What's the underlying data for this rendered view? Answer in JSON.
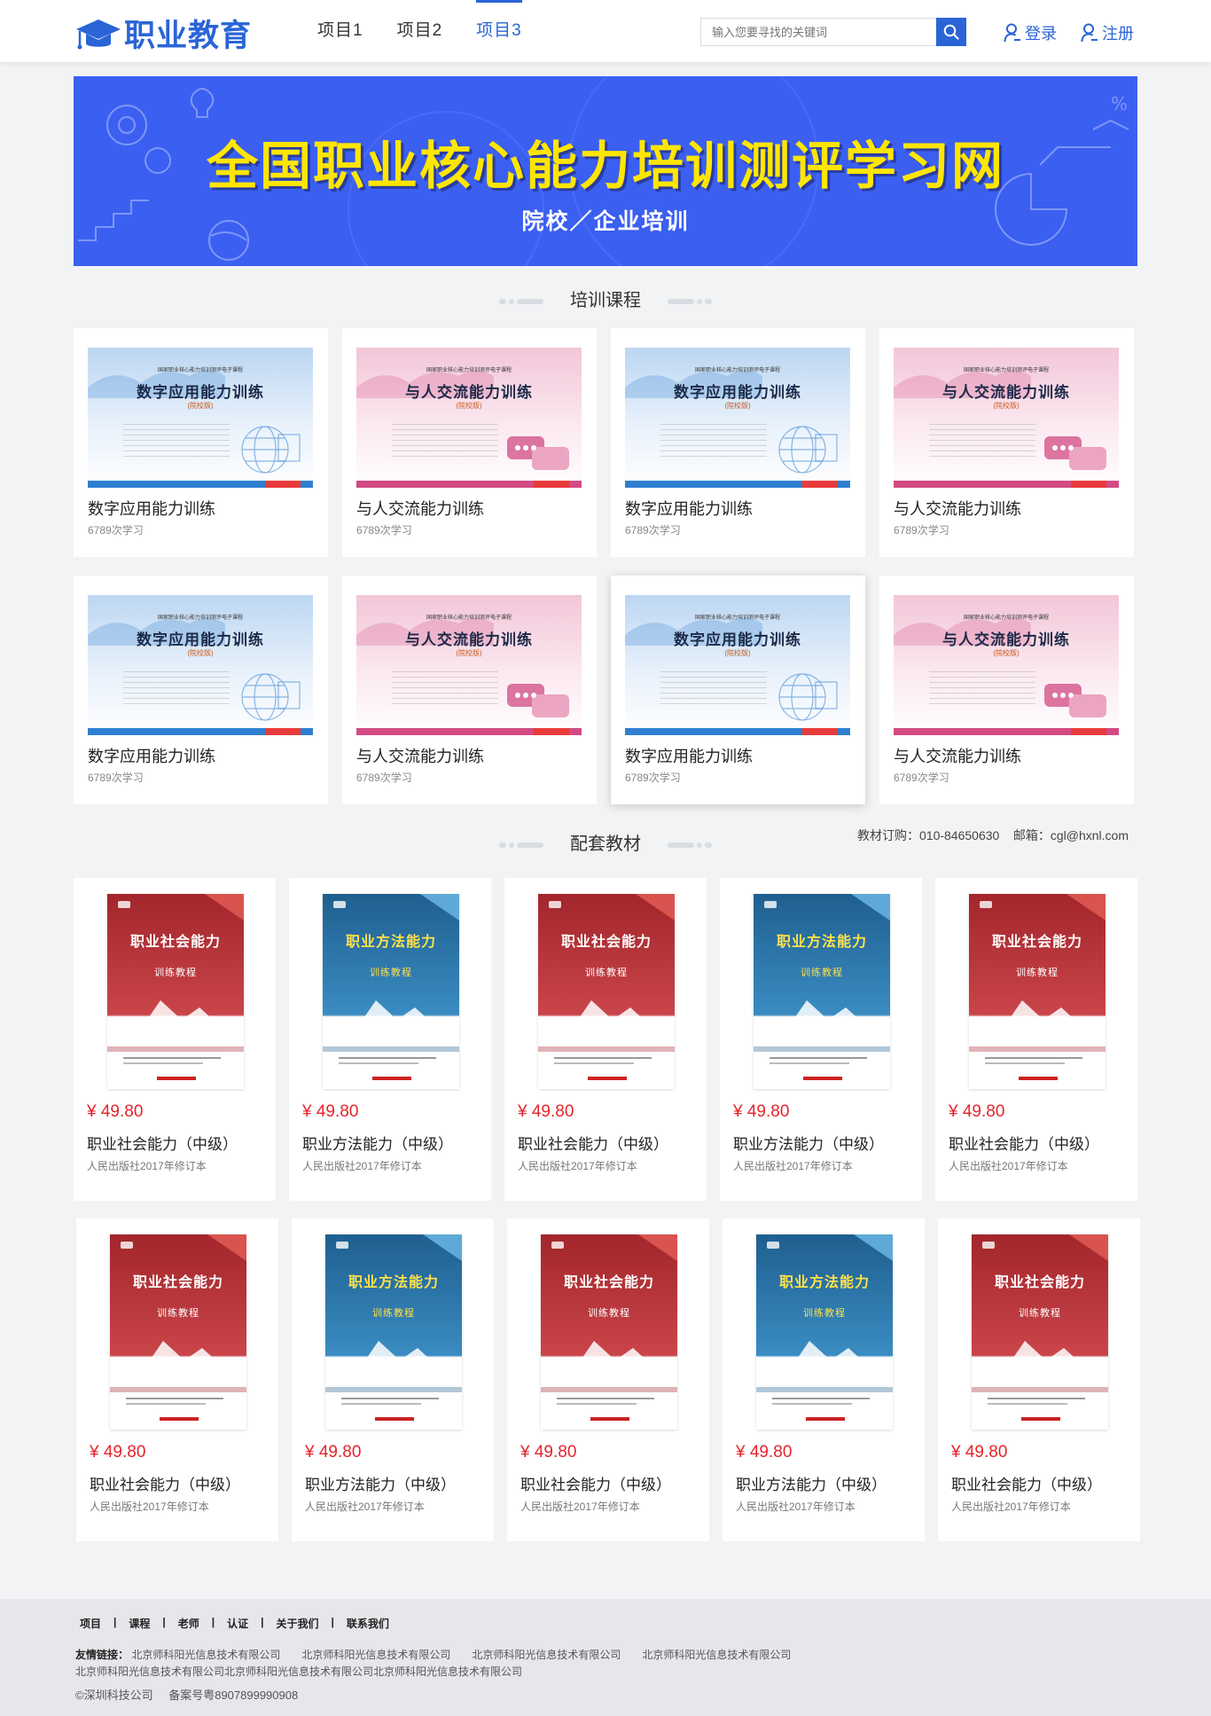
{
  "header": {
    "logo_text": "职业教育",
    "nav": [
      "项目1",
      "项目2",
      "项目3"
    ],
    "active_nav_index": 2,
    "search_placeholder": "输入您要寻找的关键词",
    "login_label": "登录",
    "register_label": "注册"
  },
  "banner": {
    "title": "全国职业核心能力培训测评学习网",
    "subtitle": "院校／企业培训",
    "background_color": "#3b5ff1",
    "title_color": "#ffe600"
  },
  "training": {
    "heading": "培训课程",
    "courses": [
      {
        "name": "数字应用能力训练",
        "count": "6789次学习",
        "cover_title": "数字应用能力训练",
        "cover_badge": "(院校版)",
        "theme": "blue"
      },
      {
        "name": "与人交流能力训练",
        "count": "6789次学习",
        "cover_title": "与人交流能力训练",
        "cover_badge": "(院校版)",
        "theme": "pink"
      },
      {
        "name": "数字应用能力训练",
        "count": "6789次学习",
        "cover_title": "数字应用能力训练",
        "cover_badge": "(院校版)",
        "theme": "blue"
      },
      {
        "name": "与人交流能力训练",
        "count": "6789次学习",
        "cover_title": "与人交流能力训练",
        "cover_badge": "(院校版)",
        "theme": "pink"
      },
      {
        "name": "数字应用能力训练",
        "count": "6789次学习",
        "cover_title": "数字应用能力训练",
        "cover_badge": "(院校版)",
        "theme": "blue"
      },
      {
        "name": "与人交流能力训练",
        "count": "6789次学习",
        "cover_title": "与人交流能力训练",
        "cover_badge": "(院校版)",
        "theme": "pink"
      },
      {
        "name": "数字应用能力训练",
        "count": "6789次学习",
        "cover_title": "数字应用能力训练",
        "cover_badge": "(院校版)",
        "theme": "blue"
      },
      {
        "name": "与人交流能力训练",
        "count": "6789次学习",
        "cover_title": "与人交流能力训练",
        "cover_badge": "(院校版)",
        "theme": "pink"
      }
    ]
  },
  "materials": {
    "heading": "配套教材",
    "order_info": "教材订购：010-84650630    邮箱：cgl@hxnl.com",
    "books": [
      {
        "price": "¥ 49.80",
        "name": "职业社会能力（中级）",
        "publisher": "人民出版社2017年修订本",
        "cover_title": "职业社会能力",
        "cover_sub": "训练教程",
        "theme": "red"
      },
      {
        "price": "¥ 49.80",
        "name": "职业方法能力（中级）",
        "publisher": "人民出版社2017年修订本",
        "cover_title": "职业方法能力",
        "cover_sub": "训练教程",
        "theme": "blue"
      },
      {
        "price": "¥ 49.80",
        "name": "职业社会能力（中级）",
        "publisher": "人民出版社2017年修订本",
        "cover_title": "职业社会能力",
        "cover_sub": "训练教程",
        "theme": "red"
      },
      {
        "price": "¥ 49.80",
        "name": "职业方法能力（中级）",
        "publisher": "人民出版社2017年修订本",
        "cover_title": "职业方法能力",
        "cover_sub": "训练教程",
        "theme": "blue"
      },
      {
        "price": "¥ 49.80",
        "name": "职业社会能力（中级）",
        "publisher": "人民出版社2017年修订本",
        "cover_title": "职业社会能力",
        "cover_sub": "训练教程",
        "theme": "red"
      },
      {
        "price": "¥ 49.80",
        "name": "职业社会能力（中级）",
        "publisher": "人民出版社2017年修订本",
        "cover_title": "职业社会能力",
        "cover_sub": "训练教程",
        "theme": "red"
      },
      {
        "price": "¥ 49.80",
        "name": "职业方法能力（中级）",
        "publisher": "人民出版社2017年修订本",
        "cover_title": "职业方法能力",
        "cover_sub": "训练教程",
        "theme": "blue"
      },
      {
        "price": "¥ 49.80",
        "name": "职业社会能力（中级）",
        "publisher": "人民出版社2017年修订本",
        "cover_title": "职业社会能力",
        "cover_sub": "训练教程",
        "theme": "red"
      },
      {
        "price": "¥ 49.80",
        "name": "职业方法能力（中级）",
        "publisher": "人民出版社2017年修订本",
        "cover_title": "职业方法能力",
        "cover_sub": "训练教程",
        "theme": "blue"
      },
      {
        "price": "¥ 49.80",
        "name": "职业社会能力（中级）",
        "publisher": "人民出版社2017年修订本",
        "cover_title": "职业社会能力",
        "cover_sub": "训练教程",
        "theme": "red"
      }
    ]
  },
  "footer": {
    "nav": [
      "项目",
      "课程",
      "老师",
      "认证",
      "关于我们",
      "联系我们"
    ],
    "friend_links_label": "友情链接：",
    "friend_links": [
      "北京师科阳光信息技术有限公司",
      "北京师科阳光信息技术有限公司",
      "北京师科阳光信息技术有限公司",
      "北京师科阳光信息技术有限公司",
      "北京师科阳光信息技术有限公司",
      "北京师科阳光信息技术有限公司",
      "北京师科阳光信息技术有限公司"
    ],
    "copyright": "©深圳科技公司",
    "icp": "备案号粤8907899990908"
  },
  "colors": {
    "accent": "#2a64d6",
    "price": "#e5242b"
  }
}
